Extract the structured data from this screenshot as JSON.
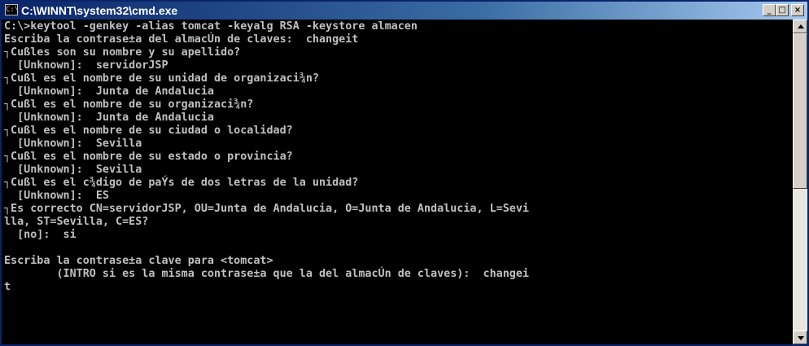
{
  "window": {
    "title": "C:\\WINNT\\system32\\cmd.exe",
    "icon_label": "C:\\",
    "minimize_glyph": "_",
    "maximize_glyph": "□",
    "close_glyph": "×"
  },
  "console": {
    "lines": [
      "C:\\>keytool -genkey -alias tomcat -keyalg RSA -keystore almacen",
      "Escriba la contrase±a del almacÚn de claves:  changeit",
      "┐Cußles son su nombre y su apellido?",
      "  [Unknown]:  servidorJSP",
      "┐Cußl es el nombre de su unidad de organizaci¾n?",
      "  [Unknown]:  Junta de Andalucia",
      "┐Cußl es el nombre de su organizaci¾n?",
      "  [Unknown]:  Junta de Andalucia",
      "┐Cußl es el nombre de su ciudad o localidad?",
      "  [Unknown]:  Sevilla",
      "┐Cußl es el nombre de su estado o provincia?",
      "  [Unknown]:  Sevilla",
      "┐Cußl es el c¾digo de paÝs de dos letras de la unidad?",
      "  [Unknown]:  ES",
      "┐Es correcto CN=servidorJSP, OU=Junta de Andalucia, O=Junta de Andalucia, L=Sevi",
      "lla, ST=Sevilla, C=ES?",
      "  [no]:  si",
      "",
      "Escriba la contrase±a clave para <tomcat>",
      "        (INTRO si es la misma contrase±a que la del almacÚn de claves):  changei",
      "t"
    ]
  }
}
